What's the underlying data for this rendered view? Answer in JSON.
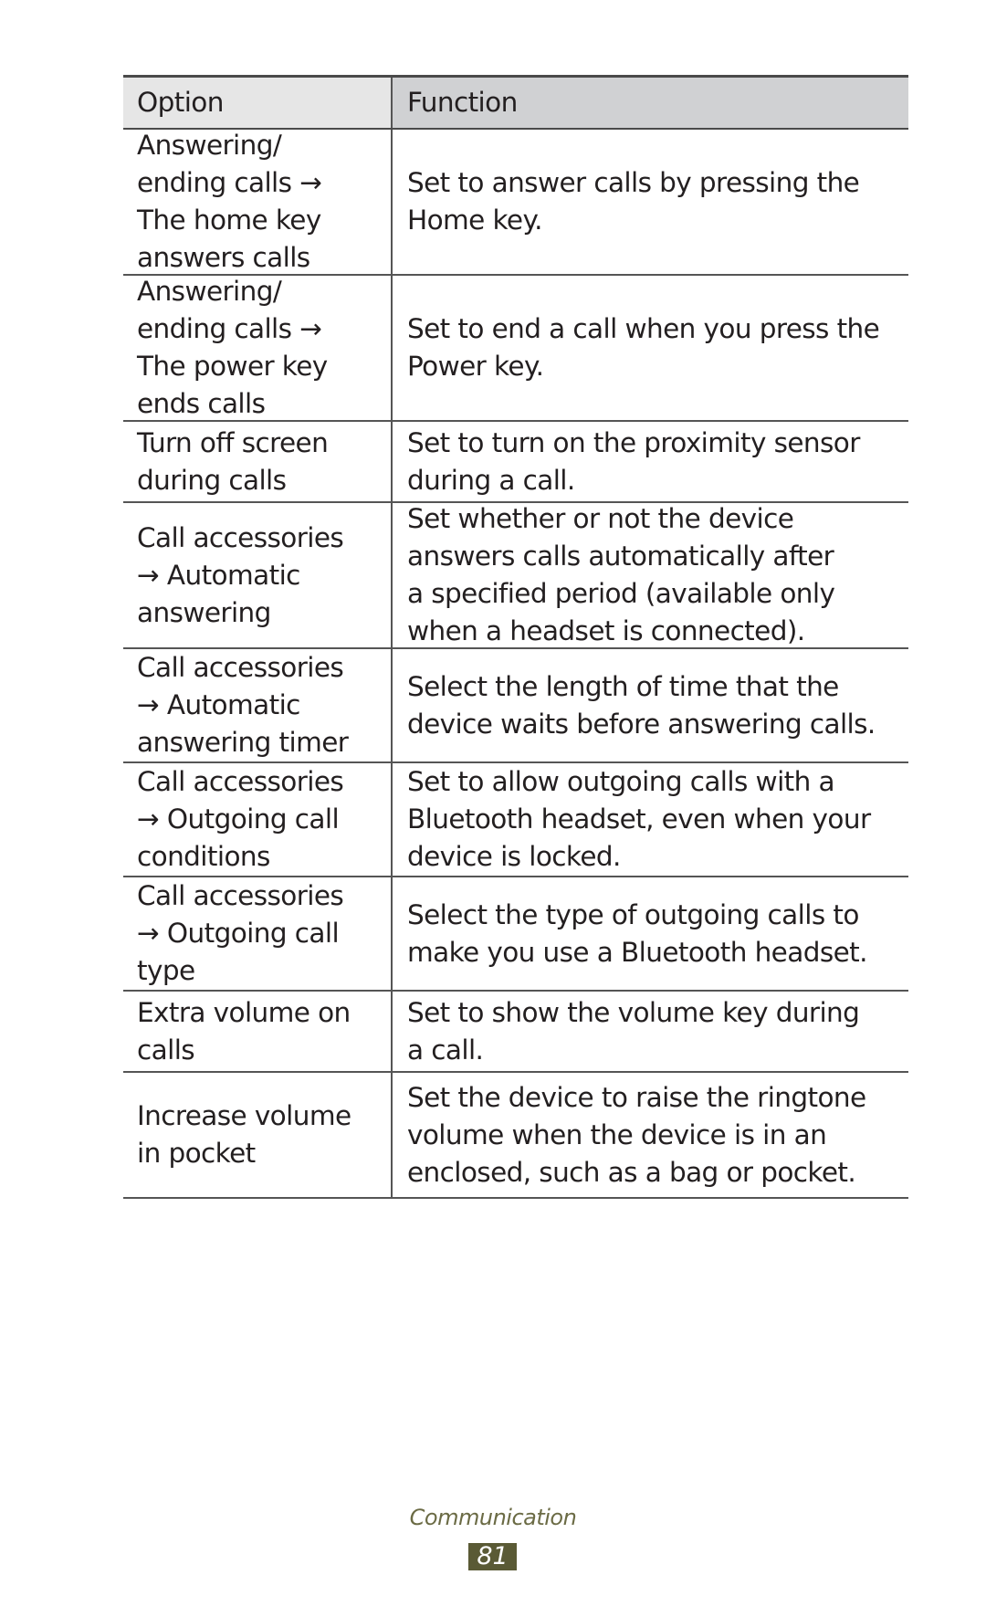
{
  "table": {
    "headers": {
      "option": "Option",
      "function": "Function"
    },
    "rows": [
      {
        "option": "Answering/\nending calls →\nThe home key\nanswers calls",
        "function": "Set to answer calls by pressing the\nHome key."
      },
      {
        "option": "Answering/\nending calls →\nThe power key\nends calls",
        "function": "Set to end a call when you press the\nPower key."
      },
      {
        "option": "Turn off screen\nduring calls",
        "function": "Set to turn on the proximity sensor\nduring a call."
      },
      {
        "option": "Call accessories\n→ Automatic\nanswering",
        "function": "Set whether or not the device\nanswers calls automatically after\na specified period (available only\nwhen a headset is connected)."
      },
      {
        "option": "Call accessories\n→ Automatic\nanswering timer",
        "function": "Select the length of time that the\ndevice waits before answering calls."
      },
      {
        "option": "Call accessories\n→ Outgoing call\nconditions",
        "function": "Set to allow outgoing calls with a\nBluetooth headset, even when your\ndevice is locked."
      },
      {
        "option": "Call accessories\n→ Outgoing call\ntype",
        "function": "Select the type of outgoing calls to\nmake you use a Bluetooth headset."
      },
      {
        "option": "Extra volume on\ncalls",
        "function": "Set to show the volume key during\na call."
      },
      {
        "option": "Increase volume\nin pocket",
        "function": "Set the device to raise the ringtone\nvolume when the device is in an\nenclosed, such as a bag or pocket."
      }
    ]
  },
  "footer": {
    "section": "Communication",
    "page_number": "81"
  },
  "colors": {
    "header_bg": "#e6e6e6",
    "header_function_bg": "#d0d1d3",
    "badge_bg": "#5a5a35",
    "section_text": "#6b6b45"
  }
}
